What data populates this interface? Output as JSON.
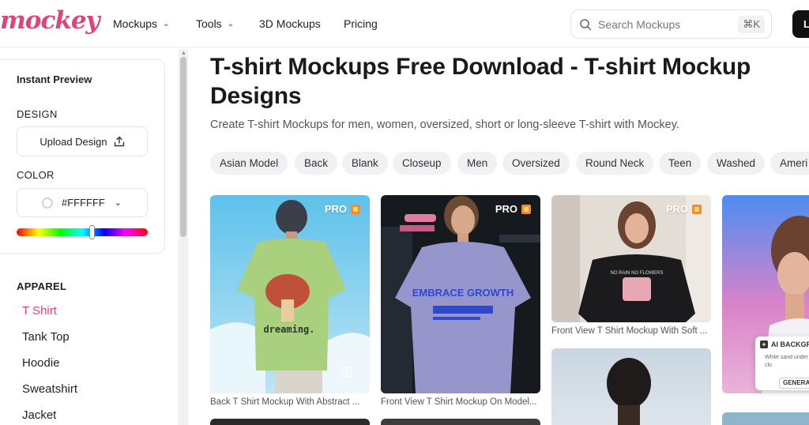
{
  "header": {
    "logo": "mockey",
    "nav": [
      {
        "label": "Mockups",
        "dropdown": true
      },
      {
        "label": "Tools",
        "dropdown": true
      },
      {
        "label": "3D Mockups",
        "dropdown": false
      },
      {
        "label": "Pricing",
        "dropdown": false
      }
    ],
    "search_placeholder": "Search Mockups",
    "search_shortcut": "⌘K",
    "login_label": "L"
  },
  "sidebar": {
    "preview_title": "Instant Preview",
    "design_label": "DESIGN",
    "upload_label": "Upload Design",
    "color_label": "COLOR",
    "color_value": "#FFFFFF",
    "apparel_title": "APPAREL",
    "categories": [
      {
        "label": "T Shirt",
        "active": true
      },
      {
        "label": "Tank Top",
        "active": false
      },
      {
        "label": "Hoodie",
        "active": false
      },
      {
        "label": "Sweatshirt",
        "active": false
      },
      {
        "label": "Jacket",
        "active": false
      }
    ]
  },
  "main": {
    "title": "T-shirt Mockups Free Download - T-shirt Mockup Designs",
    "subtitle": "Create T-shirt Mockups for men, women, oversized, short or long-sleeve T-shirt with Mockey.",
    "filters": [
      "Asian Model",
      "Back",
      "Blank",
      "Closeup",
      "Men",
      "Oversized",
      "Round Neck",
      "Teen",
      "Washed",
      "Ameri"
    ],
    "cards": [
      {
        "badge": "PRO",
        "caption": "Back T Shirt Mockup With Abstract ...",
        "print_text": "dreaming."
      },
      {
        "badge": "PRO",
        "caption": "Front View T Shirt Mockup On Model...",
        "print_text": "EMBRACE GROWTH"
      },
      {
        "badge": "PRO",
        "caption": "Front View T Shirt Mockup With Soft ...",
        "print_text": "NO RAIN NO FLOWERS"
      },
      {
        "badge": "",
        "caption": "",
        "print_text": ""
      }
    ],
    "ai_panel": {
      "title": "AI BACKGR",
      "text": "White sand under with clo",
      "button": "GENERA"
    }
  },
  "colors": {
    "brand": "#e0437a",
    "chip_bg": "#f1f1f3",
    "pro_badge": "#f58a32"
  }
}
